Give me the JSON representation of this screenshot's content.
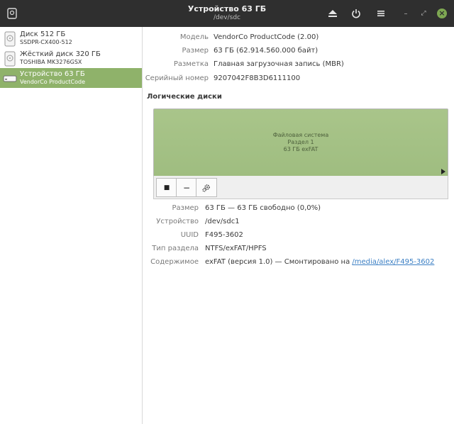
{
  "window": {
    "title": "Устройство 63 ГБ",
    "subtitle": "/dev/sdc"
  },
  "toolbar": {
    "eject_icon": "eject-icon",
    "power_icon": "power-icon",
    "menu_icon": "hamburger-menu-icon"
  },
  "window_controls": {
    "minimize": "–",
    "maximize": "⤢",
    "close": "×",
    "close_color": "#7ea852"
  },
  "sidebar": {
    "selected_color": "#8fb26a",
    "drives": [
      {
        "name": "Диск 512 ГБ",
        "model": "SSDPR-CX400-512",
        "icon": "disk-icon"
      },
      {
        "name": "Жёсткий диск 320 ГБ",
        "model": "TOSHIBA MK3276GSX",
        "icon": "hard-disk-icon"
      },
      {
        "name": "Устройство 63 ГБ",
        "model": "VendorCo ProductCode",
        "icon": "removable-drive-icon"
      }
    ]
  },
  "device": {
    "model_label": "Модель",
    "model_value": "VendorCo ProductCode (2.00)",
    "size_label": "Размер",
    "size_value": "63 ГБ (62.914.560.000 байт)",
    "partitioning_label": "Разметка",
    "partitioning_value": "Главная загрузочная запись (MBR)",
    "serial_label": "Серийный номер",
    "serial_value": "9207042F8B3D6111100"
  },
  "volumes": {
    "title": "Логические диски",
    "partition": {
      "line1": "Файловая система",
      "line2": "Раздел 1",
      "line3": "63 ГБ exFAT",
      "color": "#a5c287"
    },
    "buttons": {
      "stop": "■",
      "remove": "−"
    }
  },
  "partition_info": {
    "size_label": "Размер",
    "size_value": "63 ГБ — 63 ГБ свободно (0,0%)",
    "device_label": "Устройство",
    "device_value": "/dev/sdc1",
    "uuid_label": "UUID",
    "uuid_value": "F495-3602",
    "type_label": "Тип раздела",
    "type_value": "NTFS/exFAT/HPFS",
    "contents_label": "Содержимое",
    "contents_value": "exFAT (версия 1.0) — Смонтировано на",
    "mount_link": "/media/alex/F495-3602"
  }
}
